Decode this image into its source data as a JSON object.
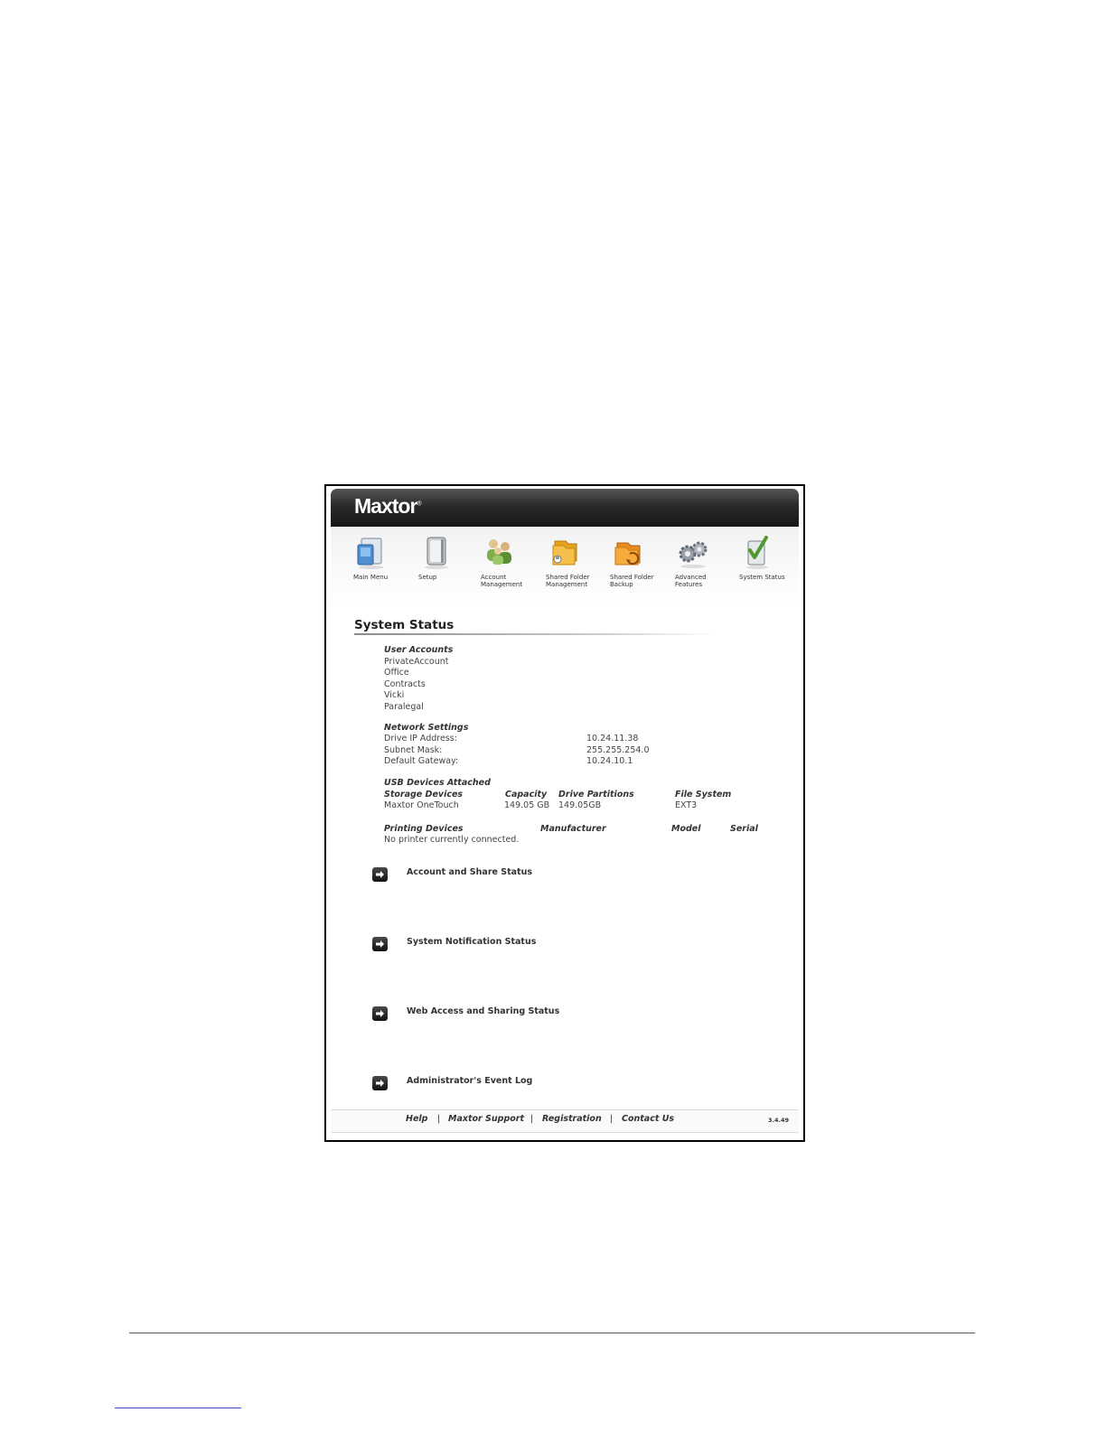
{
  "brand": {
    "logo_text": "Maxtor",
    "logo_mark": "®"
  },
  "nav": {
    "items": [
      {
        "label": "Main Menu",
        "icon": "main-menu-icon"
      },
      {
        "label": "Setup",
        "icon": "setup-icon"
      },
      {
        "label": "Account Management",
        "icon": "account-management-icon"
      },
      {
        "label": "Shared Folder Management",
        "icon": "shared-folder-management-icon"
      },
      {
        "label": "Shared Folder Backup",
        "icon": "shared-folder-backup-icon"
      },
      {
        "label": "Advanced Features",
        "icon": "advanced-features-icon"
      },
      {
        "label": "System Status",
        "icon": "system-status-icon"
      }
    ]
  },
  "page": {
    "title": "System Status"
  },
  "user_accounts": {
    "heading": "User Accounts",
    "items": [
      "PrivateAccount",
      "Office",
      "Contracts",
      "Vicki",
      "Paralegal"
    ]
  },
  "network": {
    "heading": "Network Settings",
    "rows": [
      {
        "label": "Drive IP Address:",
        "value": "10.24.11.38"
      },
      {
        "label": "Subnet Mask:",
        "value": "255.255.254.0"
      },
      {
        "label": "Default Gateway:",
        "value": "10.24.10.1"
      }
    ]
  },
  "usb": {
    "heading": "USB Devices Attached",
    "columns": [
      "Storage Devices",
      "Capacity",
      "Drive Partitions",
      "File System"
    ],
    "rows": [
      [
        "Maxtor OneTouch",
        "149.05 GB",
        "149.05GB",
        "EXT3"
      ]
    ]
  },
  "printing": {
    "columns": [
      "Printing Devices",
      "Manufacturer",
      "Model",
      "Serial"
    ],
    "empty_text": "No printer currently connected."
  },
  "links": [
    {
      "label": "Account and Share Status"
    },
    {
      "label": "System Notification Status"
    },
    {
      "label": "Web Access and Sharing Status"
    },
    {
      "label": "Administrator's Event Log"
    }
  ],
  "footer": {
    "links": [
      "Help",
      "Maxtor Support",
      "Registration",
      "Contact Us"
    ],
    "separator": "|",
    "version": "3.4.49"
  },
  "colors": {
    "header": "#1e1e1e",
    "accent_green": "#6aa83a",
    "folder_orange": "#f0a020"
  }
}
